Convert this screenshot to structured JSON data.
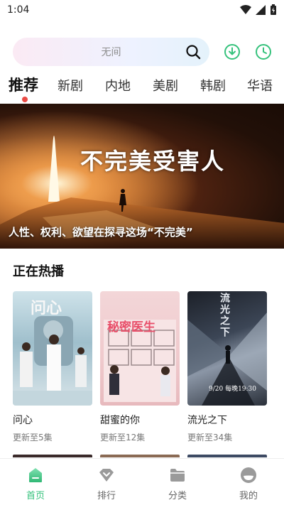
{
  "status_bar": {
    "time": "1:04"
  },
  "search": {
    "placeholder": "无间"
  },
  "tabs": [
    "推荐",
    "新剧",
    "内地",
    "美剧",
    "韩剧",
    "华语"
  ],
  "banner": {
    "title": "不完美受害人",
    "caption": "人性、权利、欲望在探寻这场“不完美”"
  },
  "section": {
    "title": "正在热播"
  },
  "cards": [
    {
      "title": "问心",
      "update": "更新至5集",
      "poster_text": "问心"
    },
    {
      "title": "甜蜜的你",
      "update": "更新至12集",
      "poster_text": "秘密医生"
    },
    {
      "title": "流光之下",
      "update": "更新至34集",
      "poster_text": "流光之下",
      "poster_sub": "9/20 每晚19:30"
    }
  ],
  "bottom_nav": [
    {
      "label": "首页",
      "icon": "home-icon",
      "active": true
    },
    {
      "label": "排行",
      "icon": "ranking-icon",
      "active": false
    },
    {
      "label": "分类",
      "icon": "category-folder-icon",
      "active": false
    },
    {
      "label": "我的",
      "icon": "profile-icon",
      "active": false
    }
  ],
  "colors": {
    "accent": "#36c27c",
    "dot": "#ea4b45"
  }
}
